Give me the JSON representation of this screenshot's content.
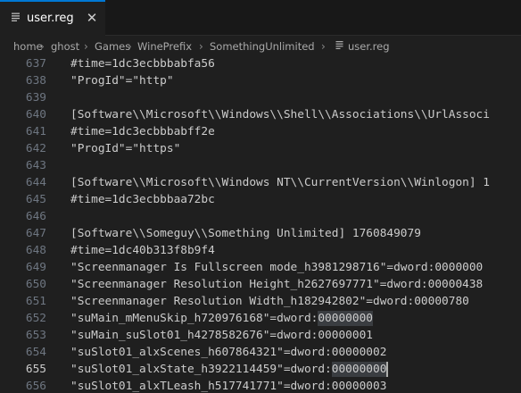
{
  "tab": {
    "title": "user.reg",
    "close_glyph": "✕",
    "file_icon": "file-lines-icon"
  },
  "breadcrumb": {
    "segments": [
      "home",
      "ghost",
      "Games",
      "WinePrefix",
      "SomethingUnlimited",
      "user.reg"
    ],
    "separator": "›"
  },
  "editor": {
    "active_line": "655",
    "lines": [
      {
        "num": "637",
        "text": "#time=1dc3ecbbbabfa56"
      },
      {
        "num": "638",
        "text": "\"ProgId\"=\"http\""
      },
      {
        "num": "639",
        "text": ""
      },
      {
        "num": "640",
        "text": "[Software\\\\Microsoft\\\\Windows\\\\Shell\\\\Associations\\\\UrlAssoci"
      },
      {
        "num": "641",
        "text": "#time=1dc3ecbbbabff2e"
      },
      {
        "num": "642",
        "text": "\"ProgId\"=\"https\""
      },
      {
        "num": "643",
        "text": ""
      },
      {
        "num": "644",
        "text": "[Software\\\\Microsoft\\\\Windows NT\\\\CurrentVersion\\\\Winlogon] 1"
      },
      {
        "num": "645",
        "text": "#time=1dc3ecbbbaa72bc"
      },
      {
        "num": "646",
        "text": ""
      },
      {
        "num": "647",
        "text": "[Software\\\\Someguy\\\\Something Unlimited] 1760849079"
      },
      {
        "num": "648",
        "text": "#time=1dc40b313f8b9f4"
      },
      {
        "num": "649",
        "text": "\"Screenmanager Is Fullscreen mode_h3981298716\"=dword:0000000"
      },
      {
        "num": "650",
        "text": "\"Screenmanager Resolution Height_h2627697771\"=dword:00000438"
      },
      {
        "num": "651",
        "text": "\"Screenmanager Resolution Width_h182942802\"=dword:00000780"
      },
      {
        "num": "652",
        "text": "\"suMain_mMenuSkip_h720976168\"=dword:00000000"
      },
      {
        "num": "653",
        "text": "\"suMain_suSlot01_h4278582676\"=dword:00000001"
      },
      {
        "num": "654",
        "text": "\"suSlot01_alxScenes_h607864321\"=dword:00000002"
      },
      {
        "num": "655",
        "text": "\"suSlot01_alxState_h3922114459\"=dword:00000000"
      },
      {
        "num": "656",
        "text": "\"suSlot01_alxTLeash_h517741771\"=dword:00000003"
      }
    ]
  }
}
